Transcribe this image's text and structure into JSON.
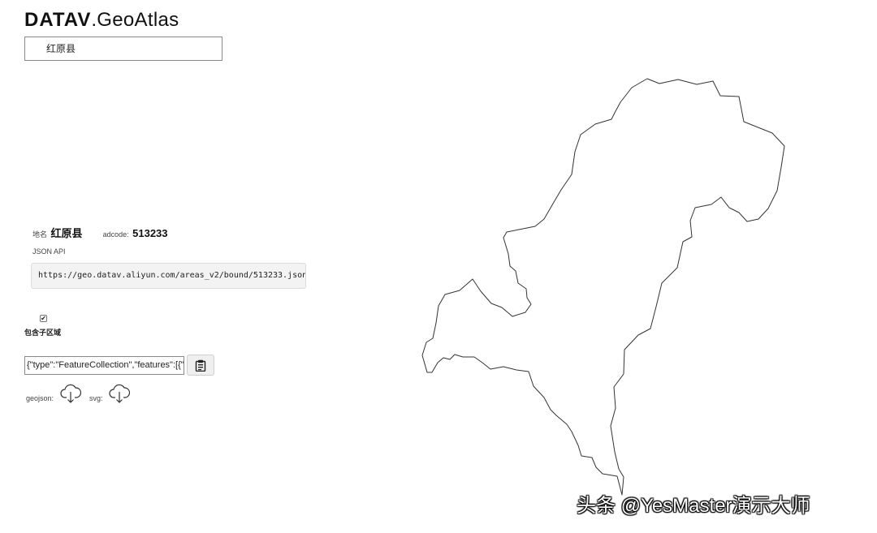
{
  "header": {
    "logo_bold": "DATAV",
    "logo_rest": ".GeoAtlas"
  },
  "search": {
    "value": "红原县"
  },
  "info": {
    "name_label": "地名",
    "name_value": "红原县",
    "adcode_label": "adcode",
    "adcode_value": "513233",
    "json_api_label": "JSON API",
    "json_api_url": "https://geo.datav.aliyun.com/areas_v2/bound/513233.json"
  },
  "options": {
    "include_subregions_label": "包含子区域",
    "include_subregions_checked": true
  },
  "output": {
    "geojson_text": "{\"type\":\"FeatureCollection\",\"features\":[{\"type\":\"Feature\"",
    "copy_icon": "clipboard-icon"
  },
  "downloads": {
    "geojson_label": "geojson:",
    "svg_label": "svg:",
    "icon": "cloud-download-icon"
  },
  "map": {
    "region": "红原县",
    "outline_color": "#333333"
  },
  "watermark": {
    "text": "头条 @YesMaster演示大师"
  }
}
